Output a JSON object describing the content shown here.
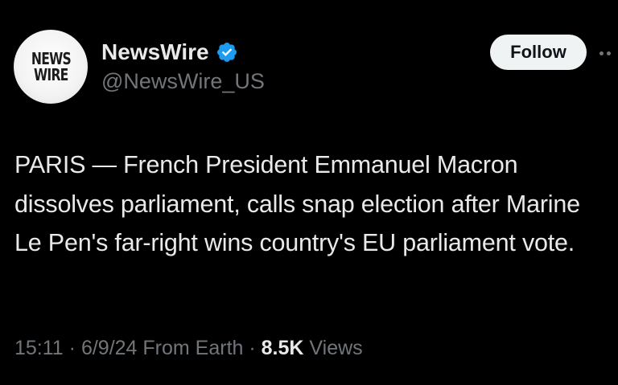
{
  "tweet": {
    "avatar": {
      "line1": "NEWS",
      "line2": "WIRE",
      "icon": "news-wire-logo"
    },
    "display_name": "NewsWire",
    "verified_icon": "verified-badge-icon",
    "handle": "@NewsWire_US",
    "follow_label": "Follow",
    "more_icon": "more-options-icon",
    "text": "PARIS — French President Emmanuel Macron dissolves parliament, calls snap election after Marine Le Pen's far-right wins country's EU parliament vote.",
    "time": "15:11",
    "sep1": " · ",
    "date": "6/9/24",
    "source": "From Earth",
    "sep2": " · ",
    "views_count": "8.5K",
    "views_label": "Views"
  },
  "colors": {
    "background": "#000000",
    "primary_text": "#e7e9ea",
    "secondary_text": "#71767b",
    "verified_blue": "#1d9bf0",
    "follow_bg": "#eff3f4"
  }
}
